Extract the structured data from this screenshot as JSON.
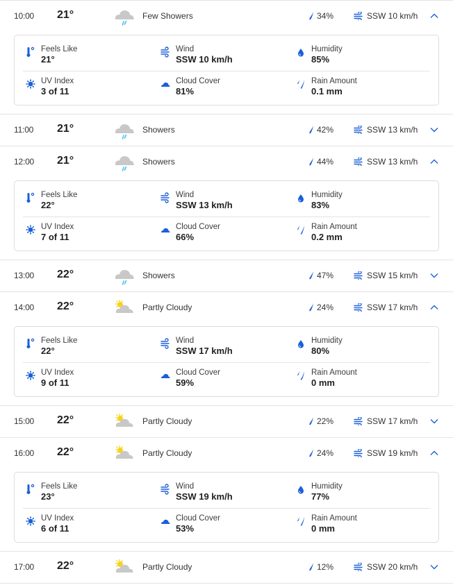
{
  "colors": {
    "accent": "#1a5fd9",
    "icon_blue": "#1a5fd9",
    "rain_cyan": "#4cc3f0",
    "cloud_gray": "#c8c8c8",
    "sun_yellow": "#f7d31e",
    "divider": "#e3e3e3"
  },
  "detail_labels": {
    "feels_like": "Feels Like",
    "wind": "Wind",
    "humidity": "Humidity",
    "uv_index": "UV Index",
    "cloud_cover": "Cloud Cover",
    "rain_amount": "Rain Amount"
  },
  "hours": [
    {
      "time": "10:00",
      "temp": "21°",
      "icon": "showers-icon",
      "condition": "Few Showers",
      "precip": "34%",
      "wind": "SSW 10 km/h",
      "expanded": true,
      "details": {
        "feels_like": "21°",
        "wind": "SSW 10 km/h",
        "humidity": "85%",
        "uv_index": "3 of 11",
        "cloud_cover": "81%",
        "rain_amount": "0.1 mm"
      }
    },
    {
      "time": "11:00",
      "temp": "21°",
      "icon": "showers-icon",
      "condition": "Showers",
      "precip": "42%",
      "wind": "SSW 13 km/h",
      "expanded": false
    },
    {
      "time": "12:00",
      "temp": "21°",
      "icon": "showers-icon",
      "condition": "Showers",
      "precip": "44%",
      "wind": "SSW 13 km/h",
      "expanded": true,
      "details": {
        "feels_like": "22°",
        "wind": "SSW 13 km/h",
        "humidity": "83%",
        "uv_index": "7 of 11",
        "cloud_cover": "66%",
        "rain_amount": "0.2 mm"
      }
    },
    {
      "time": "13:00",
      "temp": "22°",
      "icon": "showers-icon",
      "condition": "Showers",
      "precip": "47%",
      "wind": "SSW 15 km/h",
      "expanded": false
    },
    {
      "time": "14:00",
      "temp": "22°",
      "icon": "partly-cloudy-icon",
      "condition": "Partly Cloudy",
      "precip": "24%",
      "wind": "SSW 17 km/h",
      "expanded": true,
      "details": {
        "feels_like": "22°",
        "wind": "SSW 17 km/h",
        "humidity": "80%",
        "uv_index": "9 of 11",
        "cloud_cover": "59%",
        "rain_amount": "0 mm"
      }
    },
    {
      "time": "15:00",
      "temp": "22°",
      "icon": "partly-cloudy-icon",
      "condition": "Partly Cloudy",
      "precip": "22%",
      "wind": "SSW 17 km/h",
      "expanded": false
    },
    {
      "time": "16:00",
      "temp": "22°",
      "icon": "partly-cloudy-icon",
      "condition": "Partly Cloudy",
      "precip": "24%",
      "wind": "SSW 19 km/h",
      "expanded": true,
      "details": {
        "feels_like": "23°",
        "wind": "SSW 19 km/h",
        "humidity": "77%",
        "uv_index": "6 of 11",
        "cloud_cover": "53%",
        "rain_amount": "0 mm"
      }
    },
    {
      "time": "17:00",
      "temp": "22°",
      "icon": "partly-cloudy-icon",
      "condition": "Partly Cloudy",
      "precip": "12%",
      "wind": "SSW 20 km/h",
      "expanded": false
    }
  ]
}
